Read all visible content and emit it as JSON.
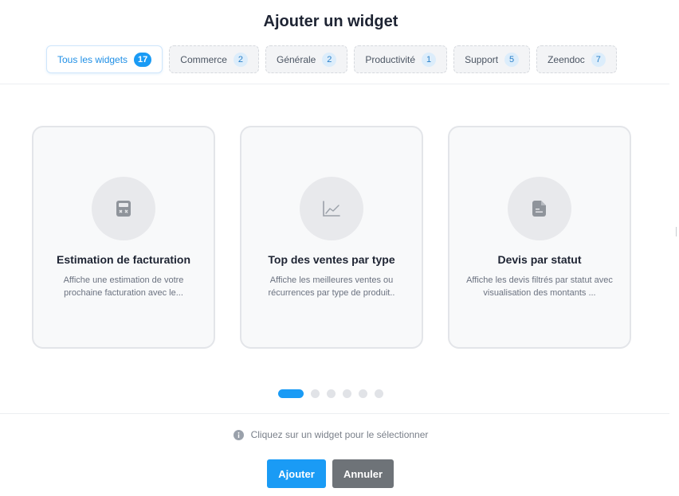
{
  "dialog": {
    "title": "Ajouter un widget"
  },
  "tabs": [
    {
      "label": "Tous les widgets",
      "count": "17",
      "active": true
    },
    {
      "label": "Commerce",
      "count": "2",
      "active": false
    },
    {
      "label": "Générale",
      "count": "2",
      "active": false
    },
    {
      "label": "Productivité",
      "count": "1",
      "active": false
    },
    {
      "label": "Support",
      "count": "5",
      "active": false
    },
    {
      "label": "Zeendoc",
      "count": "7",
      "active": false
    }
  ],
  "cards": [
    {
      "title": "Estimation de facturation",
      "description": "Affiche une estimation de votre prochaine facturation avec le...",
      "icon": "calculator-icon"
    },
    {
      "title": "Top des ventes par type",
      "description": "Affiche les meilleures ventes ou récurrences par type de produit..",
      "icon": "line-chart-icon"
    },
    {
      "title": "Devis par statut",
      "description": "Affiche les devis filtrés par statut avec visualisation des montants ...",
      "icon": "document-icon"
    }
  ],
  "pagination": {
    "page_count": 6,
    "current": 1
  },
  "hint": {
    "text": "Cliquez sur un widget pour le sélectionner",
    "icon": "info-icon"
  },
  "buttons": {
    "add_label": "Ajouter",
    "cancel_label": "Annuler"
  },
  "colors": {
    "accent": "#1a9bf5",
    "secondary_button": "#6e7378",
    "card_background": "#f8f9fa"
  }
}
